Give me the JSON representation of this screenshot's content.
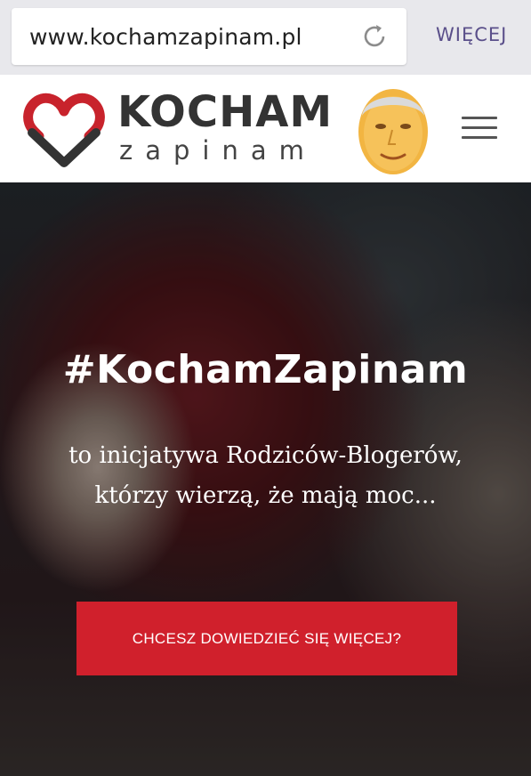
{
  "browser": {
    "url": "www.kochamzapinam.pl",
    "more_label": "WIĘCEJ",
    "reload_icon": "reload-icon"
  },
  "header": {
    "logo_top": "KOCHAM",
    "logo_bottom": "zapinam",
    "logo_icon": "heart-icon",
    "menu_icon": "hamburger-menu-icon",
    "colors": {
      "heart_red": "#c8232c",
      "heart_dark": "#333333"
    }
  },
  "hero": {
    "title": "#KochamZapinam",
    "subtitle_line1": "to inicjatywa Rodziców-Blogerów,",
    "subtitle_line2": "którzy wierzą, że mają moc...",
    "cta_label": "CHCESZ DOWIEDZIEĆ SIĘ WIĘCEJ?",
    "colors": {
      "cta": "#d0202c"
    }
  }
}
